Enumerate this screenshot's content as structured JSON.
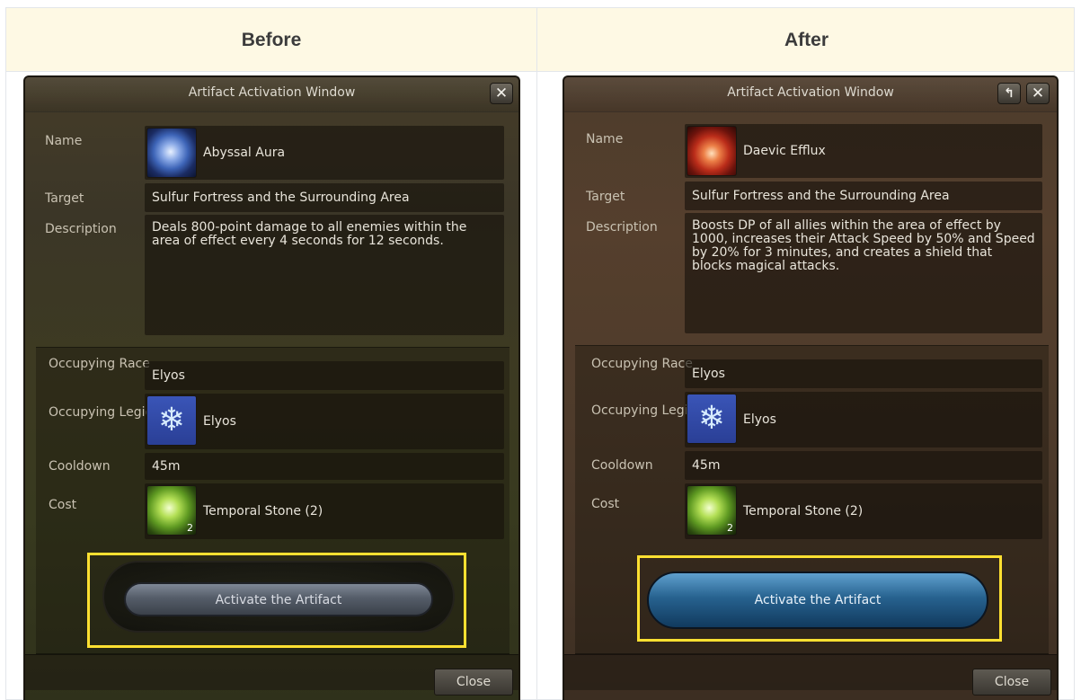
{
  "headers": {
    "before": "Before",
    "after": "After"
  },
  "window_title": "Artifact Activation Window",
  "labels": {
    "name": "Name",
    "target": "Target",
    "description": "Description",
    "occupying_race": "Occupying Race",
    "occupying_legion": "Occupying Legion",
    "cooldown": "Cooldown",
    "cost": "Cost"
  },
  "before": {
    "name": "Abyssal Aura",
    "target": "Sulfur Fortress and the Surrounding Area",
    "description": "Deals 800-point damage to all enemies within the area of effect every 4 seconds for 12 seconds.",
    "occupying_race": "Elyos",
    "occupying_legion": "Elyos",
    "cooldown": "45m",
    "cost": "Temporal Stone (2)",
    "activate_label": "Activate the Artifact",
    "close_label": "Close",
    "close_x": "✕"
  },
  "after": {
    "name": "Daevic Efflux",
    "target": "Sulfur Fortress and the Surrounding Area",
    "description": "Boosts DP of all allies within the area of effect by 1000, increases their Attack Speed by 50% and Speed by 20% for 3 minutes, and creates a shield that blocks magical attacks.",
    "occupying_race": "Elyos",
    "occupying_legion": "Elyos",
    "cooldown": "45m",
    "cost": "Temporal Stone (2)",
    "activate_label": "Activate the Artifact",
    "close_label": "Close",
    "close_x": "✕",
    "restore_glyph": "↰"
  },
  "icons": {
    "before_skill": "abyssal-aura-icon",
    "after_skill": "daevic-efflux-icon",
    "legion": "legion-emblem-icon",
    "cost": "temporal-stone-icon"
  },
  "colors": {
    "highlight": "#ffe031",
    "header_bg": "#fef9e4"
  }
}
